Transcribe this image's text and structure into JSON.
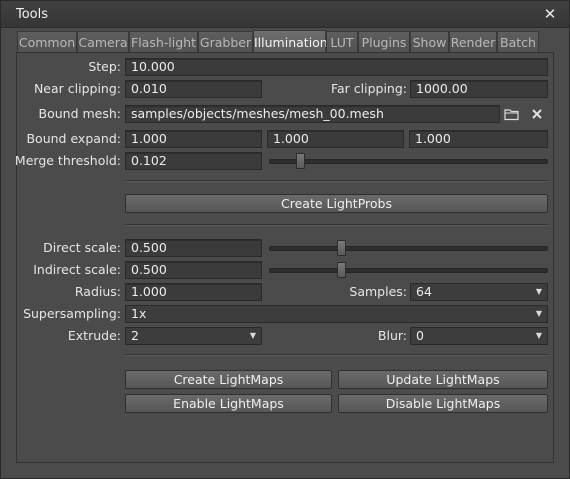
{
  "window": {
    "title": "Tools",
    "close_glyph": "✕"
  },
  "tabs": [
    {
      "label": "Common"
    },
    {
      "label": "Camera"
    },
    {
      "label": "Flash-light"
    },
    {
      "label": "Grabber"
    },
    {
      "label": "Illumination"
    },
    {
      "label": "LUT"
    },
    {
      "label": "Plugins"
    },
    {
      "label": "Show"
    },
    {
      "label": "Render"
    },
    {
      "label": "Batch"
    }
  ],
  "fields": {
    "step": {
      "label": "Step:",
      "value": "10.000"
    },
    "near_clipping": {
      "label": "Near clipping:",
      "value": "0.010"
    },
    "far_clipping": {
      "label": "Far clipping:",
      "value": "1000.00"
    },
    "bound_mesh": {
      "label": "Bound mesh:",
      "value": "samples/objects/meshes/mesh_00.mesh",
      "browse_icon": "folder-icon",
      "clear_icon": "clear-icon"
    },
    "bound_expand": {
      "label": "Bound expand:",
      "x": "1.000",
      "y": "1.000",
      "z": "1.000"
    },
    "merge_threshold": {
      "label": "Merge threshold:",
      "value": "0.102",
      "slider_fraction": 0.1
    },
    "direct_scale": {
      "label": "Direct scale:",
      "value": "0.500",
      "slider_fraction": 0.25
    },
    "indirect_scale": {
      "label": "Indirect scale:",
      "value": "0.500",
      "slider_fraction": 0.25
    },
    "radius": {
      "label": "Radius:",
      "value": "1.000"
    },
    "samples": {
      "label": "Samples:",
      "value": "64"
    },
    "supersampling": {
      "label": "Supersampling:",
      "value": "1x"
    },
    "extrude": {
      "label": "Extrude:",
      "value": "2"
    },
    "blur": {
      "label": "Blur:",
      "value": "0"
    }
  },
  "buttons": {
    "create_lightprobs": "Create LightProbs",
    "create_lightmaps": "Create LightMaps",
    "update_lightmaps": "Update LightMaps",
    "enable_lightmaps": "Enable LightMaps",
    "disable_lightmaps": "Disable LightMaps"
  },
  "combo_arrow": "▼"
}
